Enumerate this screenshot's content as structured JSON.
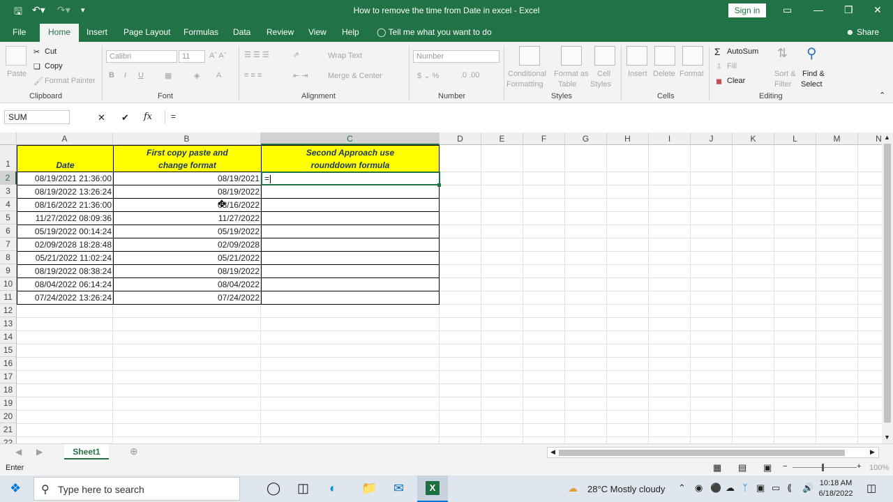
{
  "window": {
    "title": "How to remove the time from Date in excel  -  Excel",
    "sign_in": "Sign in"
  },
  "tabs": [
    "File",
    "Home",
    "Insert",
    "Page Layout",
    "Formulas",
    "Data",
    "Review",
    "View",
    "Help"
  ],
  "tell_me": "Tell me what you want to do",
  "share": "Share",
  "ribbon": {
    "clipboard": {
      "label": "Clipboard",
      "paste": "Paste",
      "cut": "Cut",
      "copy": "Copy",
      "format_painter": "Format Painter"
    },
    "font": {
      "label": "Font",
      "font_name": "Calibri",
      "font_size": "11"
    },
    "alignment": {
      "label": "Alignment",
      "wrap_text": "Wrap Text",
      "merge_center": "Merge & Center"
    },
    "number": {
      "label": "Number",
      "format": "Number"
    },
    "styles": {
      "label": "Styles",
      "conditional": "Conditional",
      "formatting": "Formatting",
      "format_as": "Format as",
      "table": "Table",
      "cell": "Cell",
      "cell_styles": "Styles"
    },
    "cells": {
      "label": "Cells",
      "insert": "Insert",
      "delete": "Delete",
      "format": "Format"
    },
    "editing": {
      "label": "Editing",
      "autosum": "AutoSum",
      "fill": "Fill",
      "clear": "Clear",
      "sort": "Sort &",
      "filter": "Filter",
      "find": "Find &",
      "select": "Select"
    }
  },
  "formula_bar": {
    "name_box": "SUM",
    "formula": "="
  },
  "columns": [
    "A",
    "B",
    "C",
    "D",
    "E",
    "F",
    "G",
    "H",
    "I",
    "J",
    "K",
    "L",
    "M",
    "N"
  ],
  "rows": [
    "1",
    "2",
    "3",
    "4",
    "5",
    "6",
    "7",
    "8",
    "9",
    "10",
    "11",
    "12",
    "13",
    "14",
    "15",
    "16",
    "17",
    "18",
    "19",
    "20",
    "21",
    "22"
  ],
  "headers": {
    "a": "Date",
    "b1": "First copy paste and",
    "b2": "change format",
    "c1": "Second Approach use",
    "c2": "rounddown formula"
  },
  "data_rows": [
    {
      "a": "08/19/2021 21:36:00",
      "b": "08/19/2021"
    },
    {
      "a": "08/19/2022 13:26:24",
      "b": "08/19/2022"
    },
    {
      "a": "08/16/2022 21:36:00",
      "b": "08/16/2022"
    },
    {
      "a": "11/27/2022 08:09:36",
      "b": "11/27/2022"
    },
    {
      "a": "05/19/2022 00:14:24",
      "b": "05/19/2022"
    },
    {
      "a": "02/09/2028 18:28:48",
      "b": "02/09/2028"
    },
    {
      "a": "05/21/2022 11:02:24",
      "b": "05/21/2022"
    },
    {
      "a": "08/19/2022 08:38:24",
      "b": "08/19/2022"
    },
    {
      "a": "08/04/2022 06:14:24",
      "b": "08/04/2022"
    },
    {
      "a": "07/24/2022 13:26:24",
      "b": "07/24/2022"
    }
  ],
  "active_cell_entry": "=",
  "sheet_tab": "Sheet1",
  "status": {
    "mode": "Enter",
    "zoom": "100%"
  },
  "taskbar": {
    "search_placeholder": "Type here to search",
    "weather": "28°C  Mostly cloudy",
    "time": "10:18 AM",
    "date": "6/18/2022"
  }
}
